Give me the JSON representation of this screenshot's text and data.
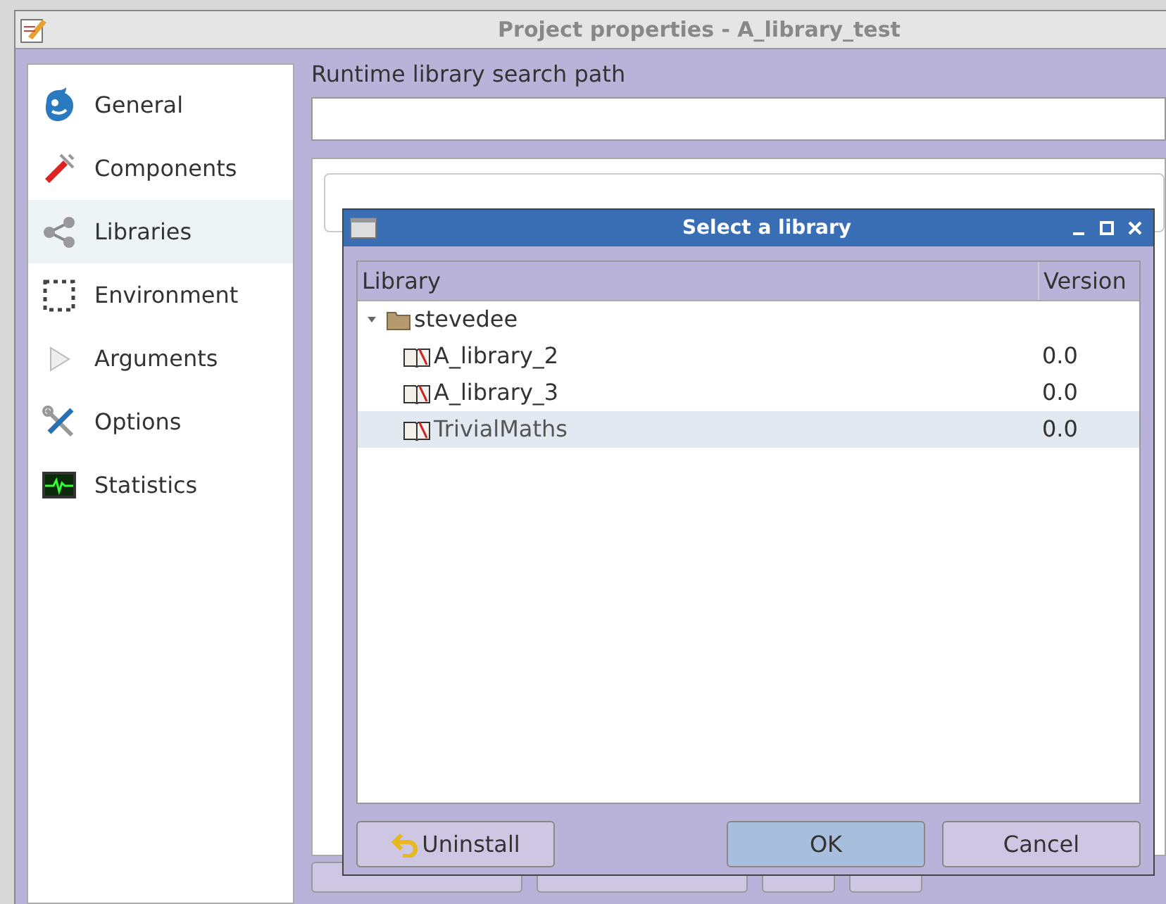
{
  "window": {
    "title": "Project properties - A_library_test"
  },
  "sidebar": {
    "items": [
      {
        "label": "General",
        "selected": false
      },
      {
        "label": "Components",
        "selected": false
      },
      {
        "label": "Libraries",
        "selected": true
      },
      {
        "label": "Environment",
        "selected": false
      },
      {
        "label": "Arguments",
        "selected": false
      },
      {
        "label": "Options",
        "selected": false
      },
      {
        "label": "Statistics",
        "selected": false
      }
    ]
  },
  "search_path": {
    "label": "Runtime library search path"
  },
  "dialog": {
    "title": "Select a library",
    "columns": [
      "Library",
      "Version"
    ],
    "tree": [
      {
        "label": "stevedee",
        "kind": "folder",
        "expanded": true,
        "selected": false,
        "children": [
          {
            "label": "A_library_2",
            "kind": "library",
            "version": "0.0",
            "selected": false
          },
          {
            "label": "A_library_3",
            "kind": "library",
            "version": "0.0",
            "selected": false
          },
          {
            "label": "TrivialMaths",
            "kind": "library",
            "version": "0.0",
            "selected": true
          }
        ]
      }
    ],
    "buttons": [
      {
        "label": "Uninstall",
        "kind": "uninstall",
        "default": false
      },
      {
        "label": "OK",
        "kind": "ok",
        "default": true
      },
      {
        "label": "Cancel",
        "kind": "cancel",
        "default": false
      }
    ]
  }
}
